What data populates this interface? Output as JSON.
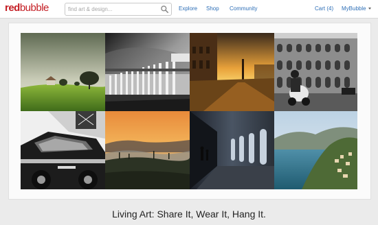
{
  "header": {
    "logo_red": "red",
    "logo_bubble": "bubble",
    "search_placeholder": "find art & design...",
    "nav": {
      "explore": "Explore",
      "shop": "Shop",
      "community": "Community",
      "cart": "Cart (4)",
      "account": "MyBubble"
    }
  },
  "gallery": {
    "tiles": [
      "green-field-trees",
      "colonnade-bw",
      "venice-sunset",
      "colosseum-scooter",
      "vintage-car-bw",
      "tuscany-hills-dusk",
      "arcade-walkway-dark",
      "amalfi-coast"
    ]
  },
  "tagline": "Living Art: Share It, Wear It, Hang It.",
  "colors": {
    "brand_red": "#c41d23",
    "link_blue": "#2e6fb7"
  }
}
